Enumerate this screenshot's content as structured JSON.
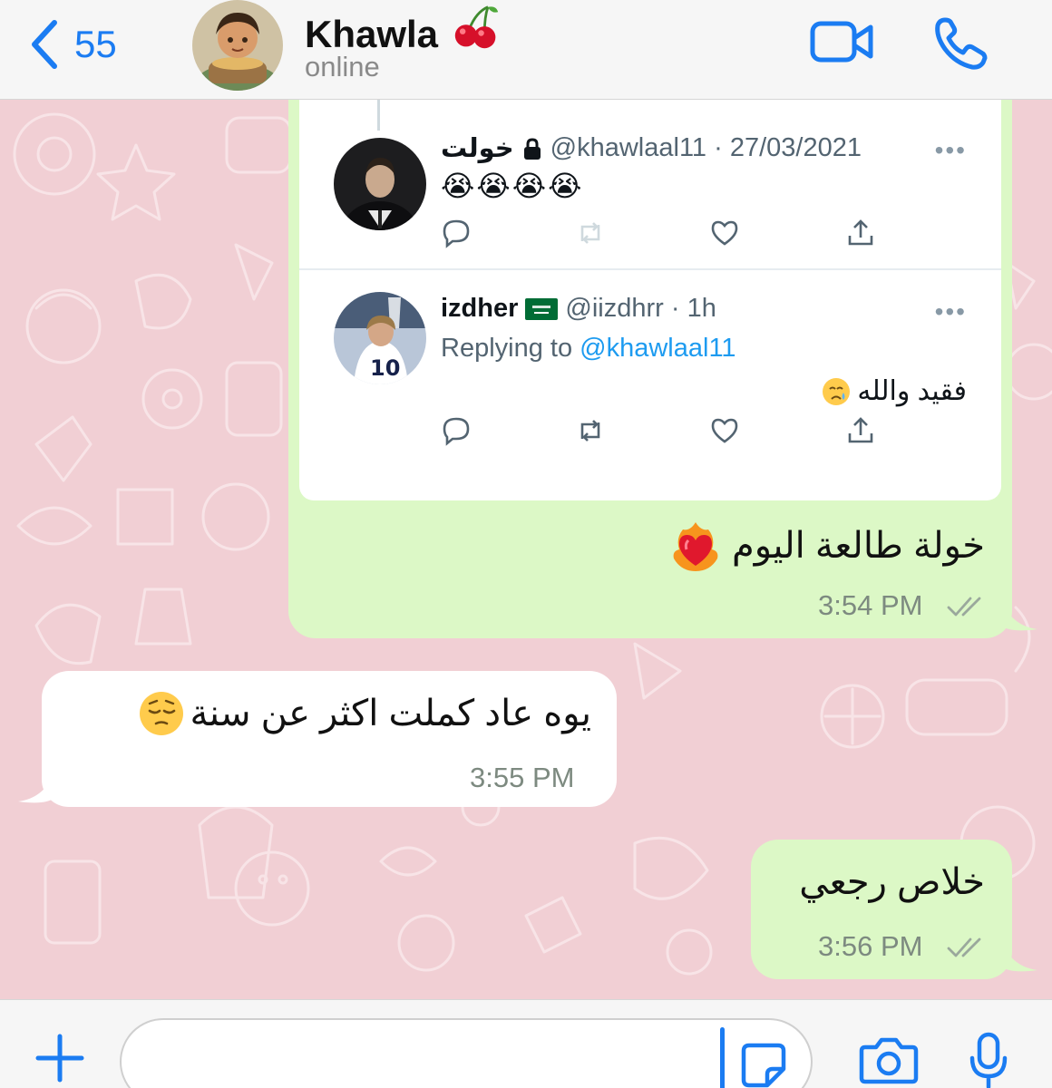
{
  "header": {
    "back_count": "55",
    "contact_name": "Khawla",
    "contact_status": "online"
  },
  "quoted_tweets": [
    {
      "name": "خولت",
      "handle_date": "@khawlaal11 · 27/03/2021",
      "text": "😭😭😭😭"
    },
    {
      "name": "izdher",
      "handle_time": "@iizdhrr · 1h",
      "replying_prefix": "Replying to",
      "replying_handle": "@khawlaal11",
      "text": "فقيد والله"
    }
  ],
  "messages": [
    {
      "direction": "out",
      "text": "خولة طالعة اليوم",
      "time": "3:54 PM"
    },
    {
      "direction": "in",
      "text": "يوه عاد كملت اكثر عن سنة",
      "time": "3:55 PM"
    },
    {
      "direction": "out",
      "text": "خلاص رجعي",
      "time": "3:56 PM"
    }
  ],
  "colors": {
    "accent": "#1b7cf2",
    "outgoing_bubble": "#dcf8c6",
    "incoming_bubble": "#ffffff",
    "chat_background": "#f1cfd4",
    "link": "#1d9bf0"
  },
  "icons": {
    "back": "chevron-left-icon",
    "video": "video-camera-icon",
    "call": "phone-icon",
    "attach": "plus-icon",
    "sticker": "sticker-icon",
    "camera": "camera-icon",
    "mic": "microphone-icon"
  }
}
